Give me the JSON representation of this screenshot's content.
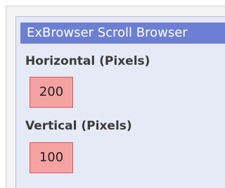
{
  "panel": {
    "title": "ExBrowser Scroll Browser",
    "horizontal": {
      "label": "Horizontal (Pixels)",
      "value": "200"
    },
    "vertical": {
      "label": "Vertical (Pixels)",
      "value": "100"
    }
  },
  "colors": {
    "header_bg": "#6d7fd3",
    "panel_bg": "#e6e9f6",
    "value_bg": "#f4a2a2",
    "value_border": "#d95b5b"
  }
}
